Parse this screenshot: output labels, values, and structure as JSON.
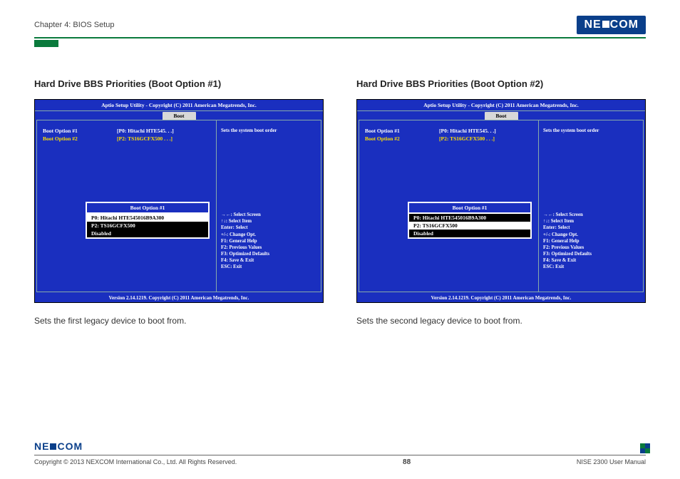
{
  "header": {
    "chapter": "Chapter 4: BIOS Setup",
    "brand": "NEXCOM"
  },
  "sections": [
    {
      "heading": "Hard Drive BBS Priorities (Boot Option #1)",
      "caption": "Sets the first legacy device to boot from."
    },
    {
      "heading": "Hard Drive BBS Priorities (Boot Option #2)",
      "caption": "Sets the second legacy device to boot from."
    }
  ],
  "bios": {
    "titlebar": "Aptio Setup Utility - Copyright (C) 2011 American Megatrends, Inc.",
    "tab": "Boot",
    "options": [
      {
        "label": "Boot Option #1",
        "value": "[P0: Hitachi HTE545. . .]"
      },
      {
        "label": "Boot Option #2",
        "value": "[P2: TS16GCFX500  . . .]"
      }
    ],
    "help_title": "Sets the system boot order",
    "help_keys": [
      "→←: Select Screen",
      "↑↓: Select Item",
      "Enter: Select",
      "+/-: Change Opt.",
      "F1: General Help",
      "F2: Previous Values",
      "F3: Optimized Defaults",
      "F4: Save & Exit",
      "ESC: Exit"
    ],
    "popups": [
      {
        "title": "Boot Option #1",
        "items": [
          "P0: Hitachi HTE545016B9A300",
          "P2: TS16GCFX500",
          "Disabled"
        ],
        "selected_index": 0
      },
      {
        "title": "Boot Option #1",
        "items": [
          "P0: Hitachi HTE545016B9A300",
          "P2: TS16GCFX500",
          "Disabled"
        ],
        "selected_index": 1
      }
    ],
    "footer": "Version 2.14.1219. Copyright (C) 2011 American Megatrends, Inc."
  },
  "page_footer": {
    "brand": "NEXCOM",
    "copyright": "Copyright © 2013 NEXCOM International Co., Ltd. All Rights Reserved.",
    "page_number": "88",
    "doc_title": "NISE 2300 User Manual"
  }
}
